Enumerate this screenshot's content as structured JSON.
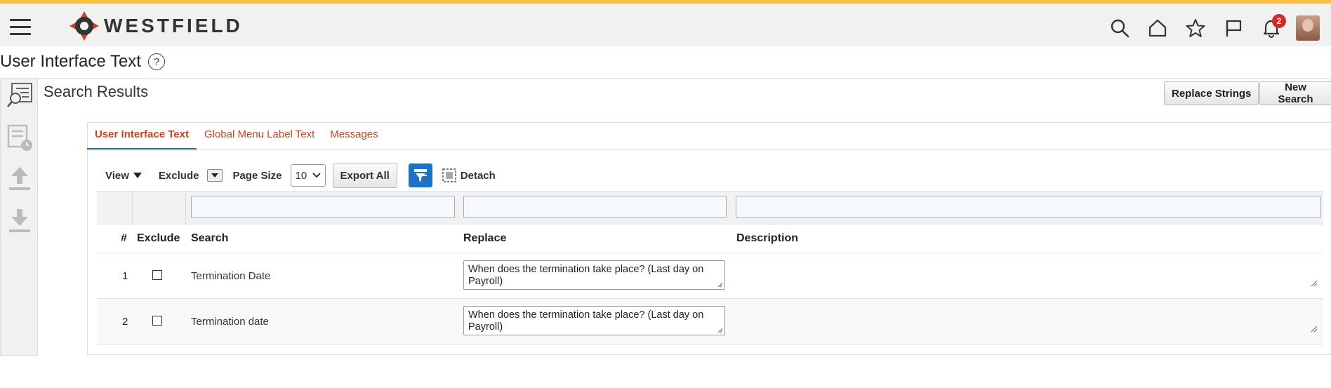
{
  "header": {
    "brand": "WESTFIELD",
    "notification_count": "2"
  },
  "page": {
    "title": "User Interface Text"
  },
  "panel": {
    "title": "Search Results",
    "replace_strings_label": "Replace Strings",
    "new_search_label": "New Search"
  },
  "tabs": [
    {
      "label": "User Interface Text",
      "active": true
    },
    {
      "label": "Global Menu Label Text",
      "active": false
    },
    {
      "label": "Messages",
      "active": false
    }
  ],
  "toolbar": {
    "view_label": "View",
    "exclude_label": "Exclude",
    "page_size_label": "Page Size",
    "page_size_value": "10",
    "export_all_label": "Export All",
    "detach_label": "Detach"
  },
  "table": {
    "columns": {
      "num": "#",
      "exclude": "Exclude",
      "search": "Search",
      "replace": "Replace",
      "description": "Description"
    },
    "rows": [
      {
        "num": "1",
        "search": "Termination Date",
        "replace": "When does the termination take place? (Last day on Payroll)"
      },
      {
        "num": "2",
        "search": "Termination date",
        "replace": "When does the termination take place? (Last day on Payroll)"
      }
    ]
  },
  "colors": {
    "accent_bar": "#f5c242",
    "tab_text": "#d0421b",
    "tab_active_underline": "#1a6fd1",
    "filter_button": "#1a73c7",
    "badge": "#d6282b"
  }
}
